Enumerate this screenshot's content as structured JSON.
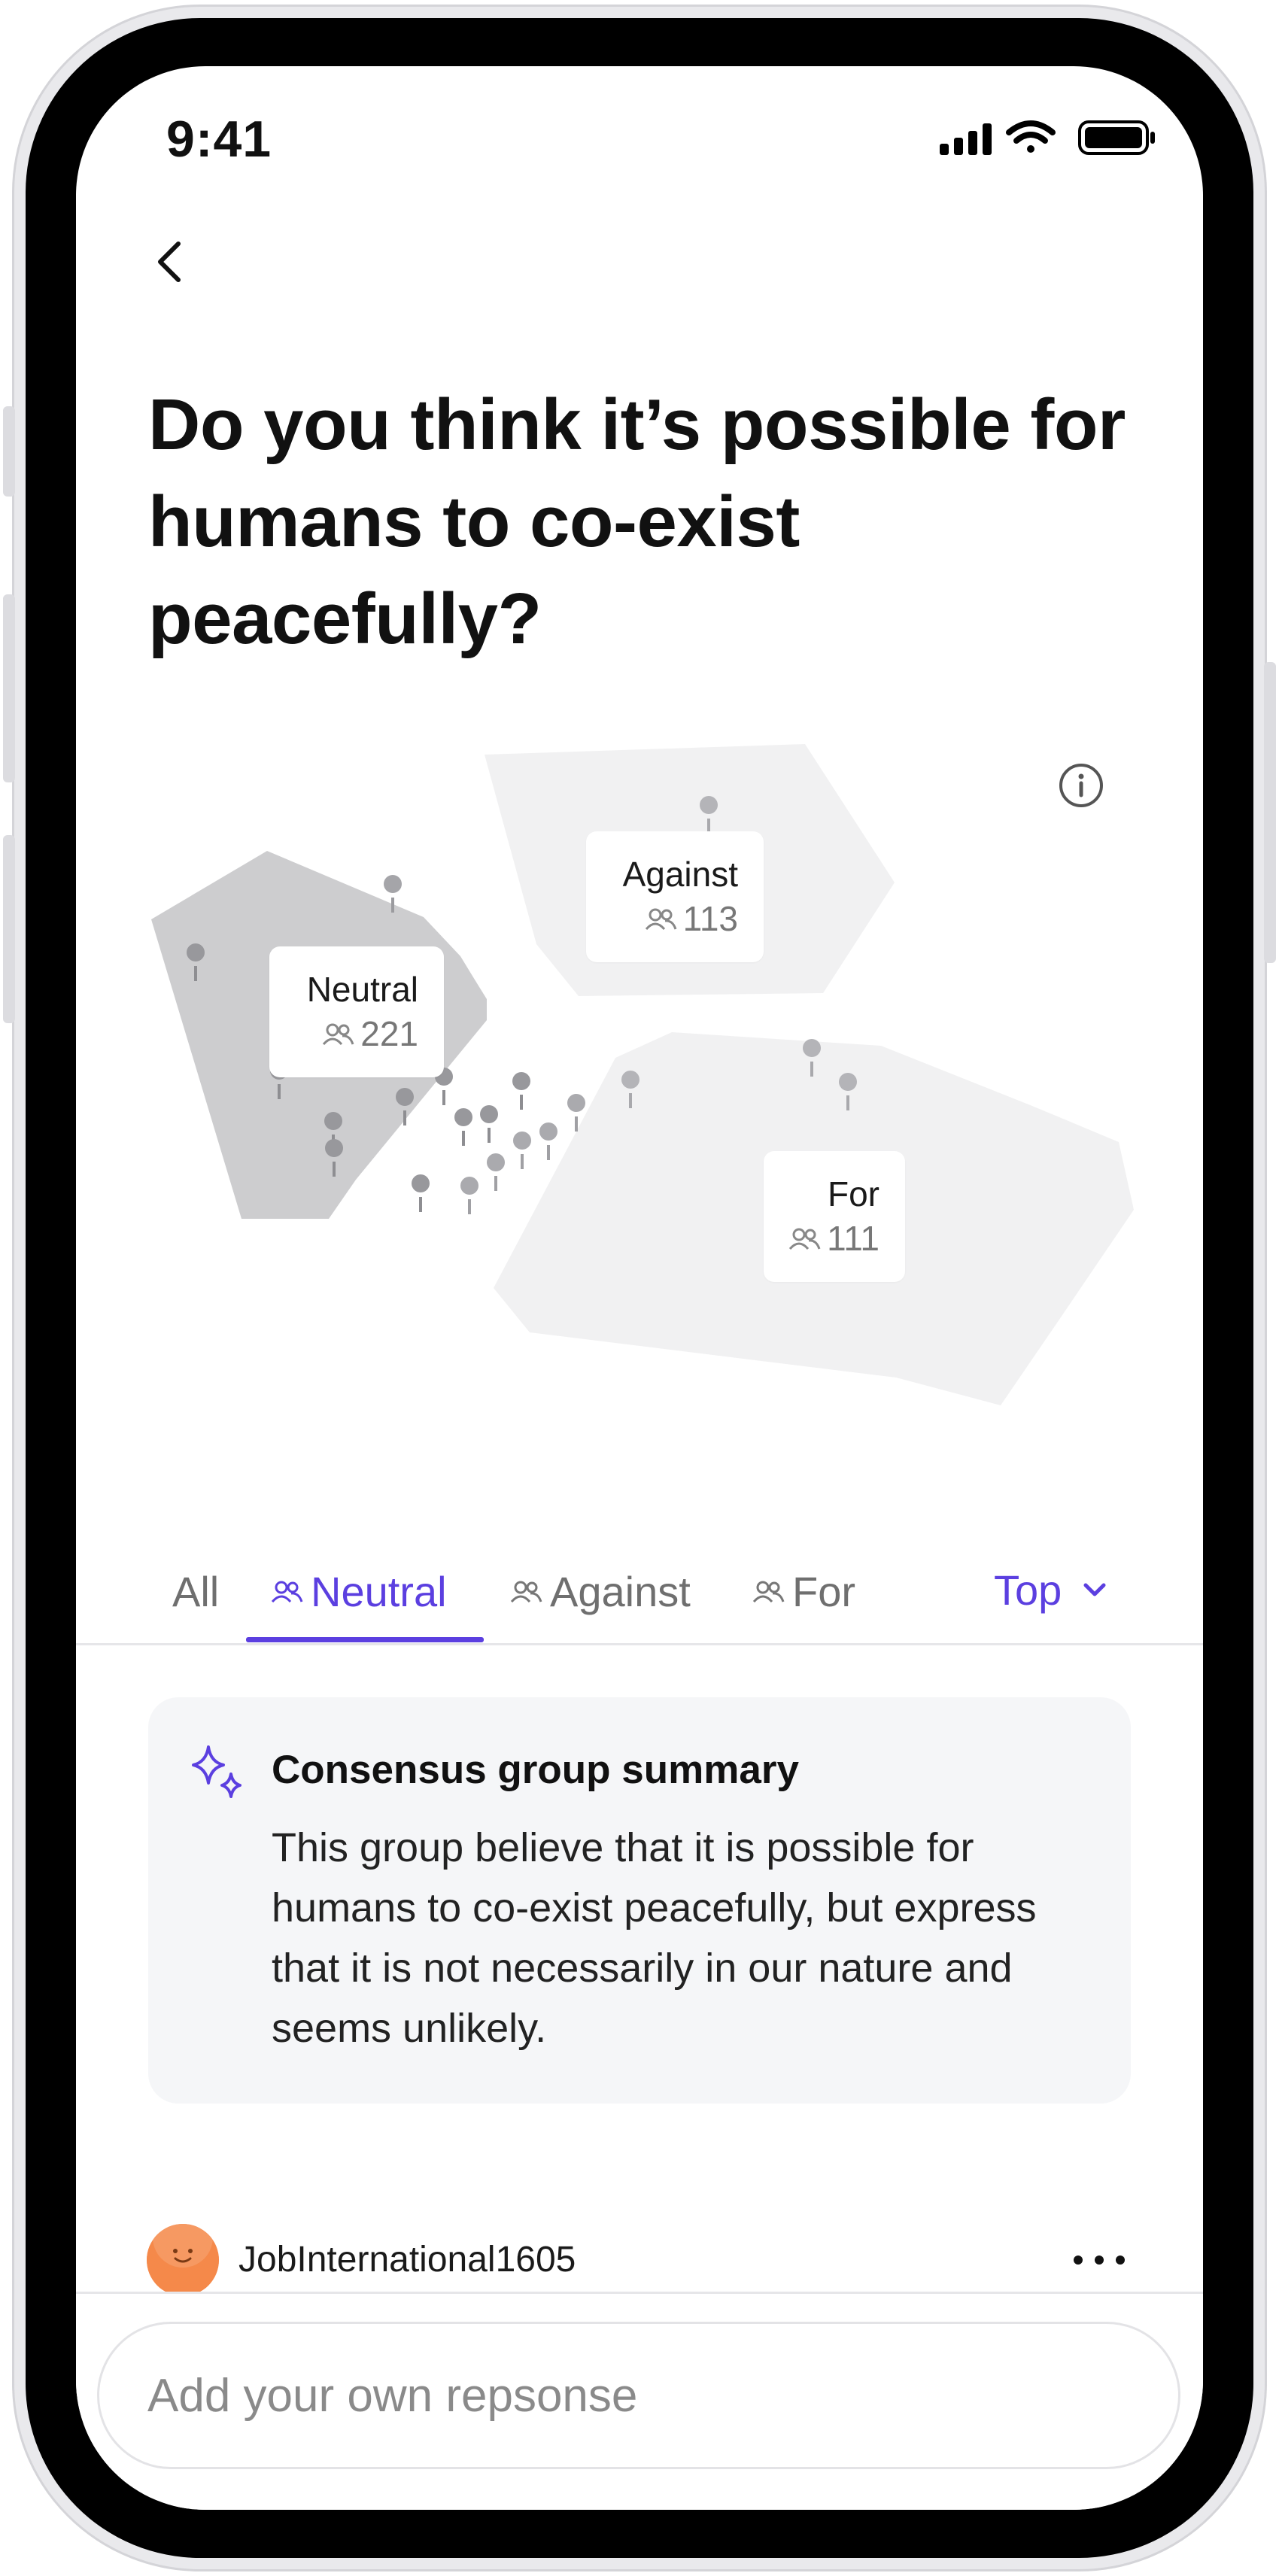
{
  "status_bar": {
    "time": "9:41"
  },
  "question": {
    "title": "Do you think it’s possible for humans to co-exist peacefully?"
  },
  "groups": [
    {
      "name": "Neutral",
      "count": "221"
    },
    {
      "name": "Against",
      "count": "113"
    },
    {
      "name": "For",
      "count": "111"
    }
  ],
  "tabs": {
    "items": [
      {
        "label": "All"
      },
      {
        "label": "Neutral"
      },
      {
        "label": "Against"
      },
      {
        "label": "For"
      }
    ],
    "active": "Neutral",
    "sort_label": "Top"
  },
  "summary": {
    "title": "Consensus group summary",
    "body": "This group believe that it is possible for humans to co-exist peacefully, but express that it is not necessarily in our nature and seems unlikely."
  },
  "comment": {
    "username": "JobInternational1605"
  },
  "composer": {
    "placeholder": "Add your own repsonse"
  },
  "colors": {
    "accent": "#5b3fe0",
    "neutral_region": "#cdcdcf",
    "other_region": "#f1f1f2",
    "avatar": "#f5894a"
  }
}
